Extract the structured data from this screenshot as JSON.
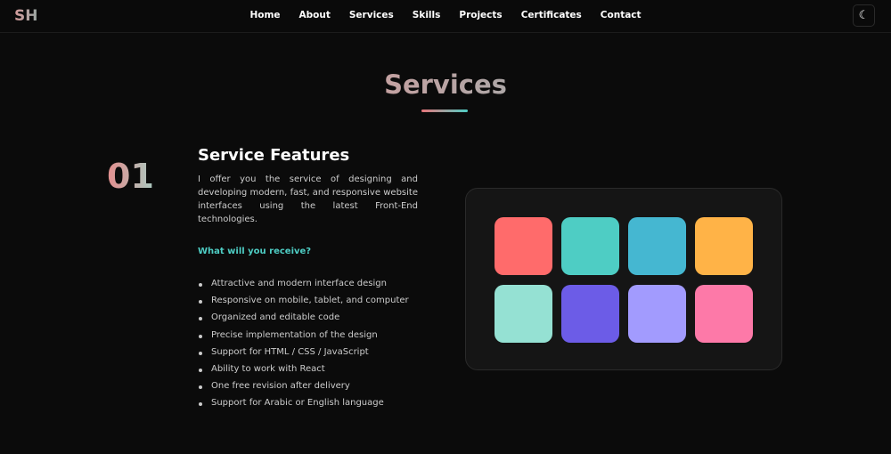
{
  "nav": {
    "logo": "SH",
    "links": [
      "Home",
      "About",
      "Services",
      "Skills",
      "Projects",
      "Certificates",
      "Contact"
    ],
    "theme_icon": "moon-icon"
  },
  "section": {
    "title": "Services"
  },
  "service": {
    "number": "01",
    "title": "Service Features",
    "description": "I offer you the service of designing and developing modern, fast, and responsive website interfaces using the latest Front-End technologies.",
    "question": "What will you receive?",
    "items": [
      "Attractive and modern interface design",
      "Responsive on mobile, tablet, and computer",
      "Organized and editable code",
      "Precise implementation of the design",
      "Support for HTML / CSS / JavaScript",
      "Ability to work with React",
      "One free revision after delivery",
      "Support for Arabic or English language"
    ]
  },
  "tiles": [
    "#ff6b6b",
    "#4ecdc4",
    "#45b7d1",
    "#ffb347",
    "#95e1d3",
    "#6c5ce7",
    "#a29bfe",
    "#fd79a8"
  ]
}
